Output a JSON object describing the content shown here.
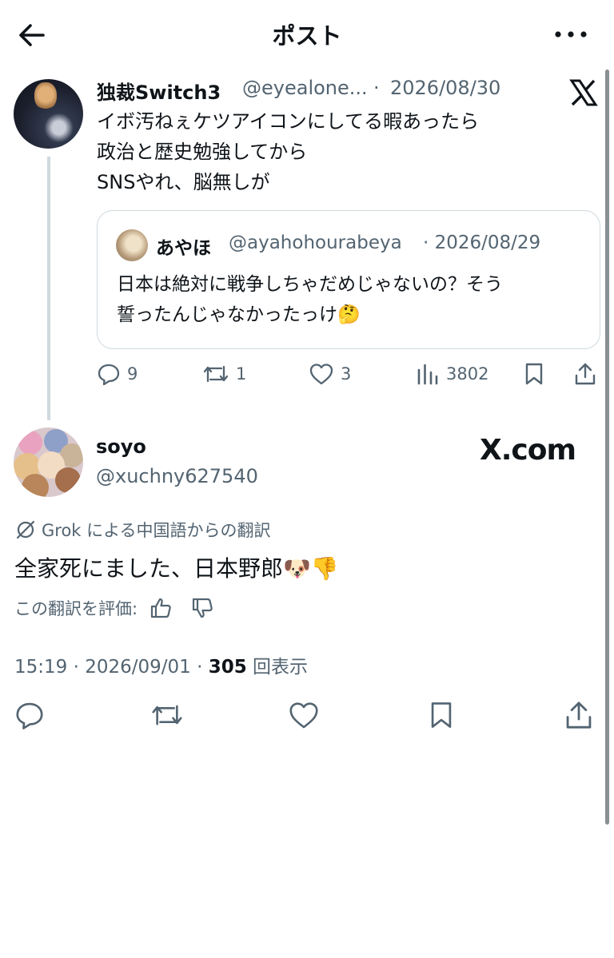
{
  "header": {
    "title": "ポスト"
  },
  "post1": {
    "name": "独裁Switch3",
    "handle": "@eyealone...",
    "separator": "·",
    "date": "2026/08/30",
    "lines": [
      "イボ汚ねぇケツアイコンにしてる暇あったら",
      "政治と歴史勉強してから",
      "SNSやれ、脳無しが"
    ],
    "quote": {
      "name": "あやほ",
      "handle": "@ayahohourabeya",
      "date": "· 2026/08/29",
      "lines": [
        "日本は絶対に戦争しちゃだめじゃないの？そう",
        "誓ったんじゃなかったっけ🤔"
      ]
    },
    "actions": {
      "replies": "9",
      "reposts": "1",
      "likes": "3",
      "views": "3802"
    }
  },
  "post2": {
    "name": "soyo",
    "handle": "@xuchny627540",
    "watermark": "X.com",
    "translation_note": "Grok による中国語からの翻訳",
    "text": "全家死にました、日本野郎🐶👎",
    "rate_label": "この翻訳を評価:",
    "time": "15:19 · 2026/09/01 · ",
    "views_count": "305",
    "views_label": " 回表示"
  },
  "icons": {
    "back": "arrow-left-icon",
    "more": "more-dots-icon",
    "x_logo": "x-logo-icon",
    "reply": "reply-icon",
    "repost": "repost-icon",
    "like": "heart-icon",
    "views": "views-bar-icon",
    "bookmark": "bookmark-icon",
    "share": "share-icon"
  },
  "colors": {
    "text": "#0f1419",
    "muted": "#536471",
    "border": "#cfd9de"
  }
}
